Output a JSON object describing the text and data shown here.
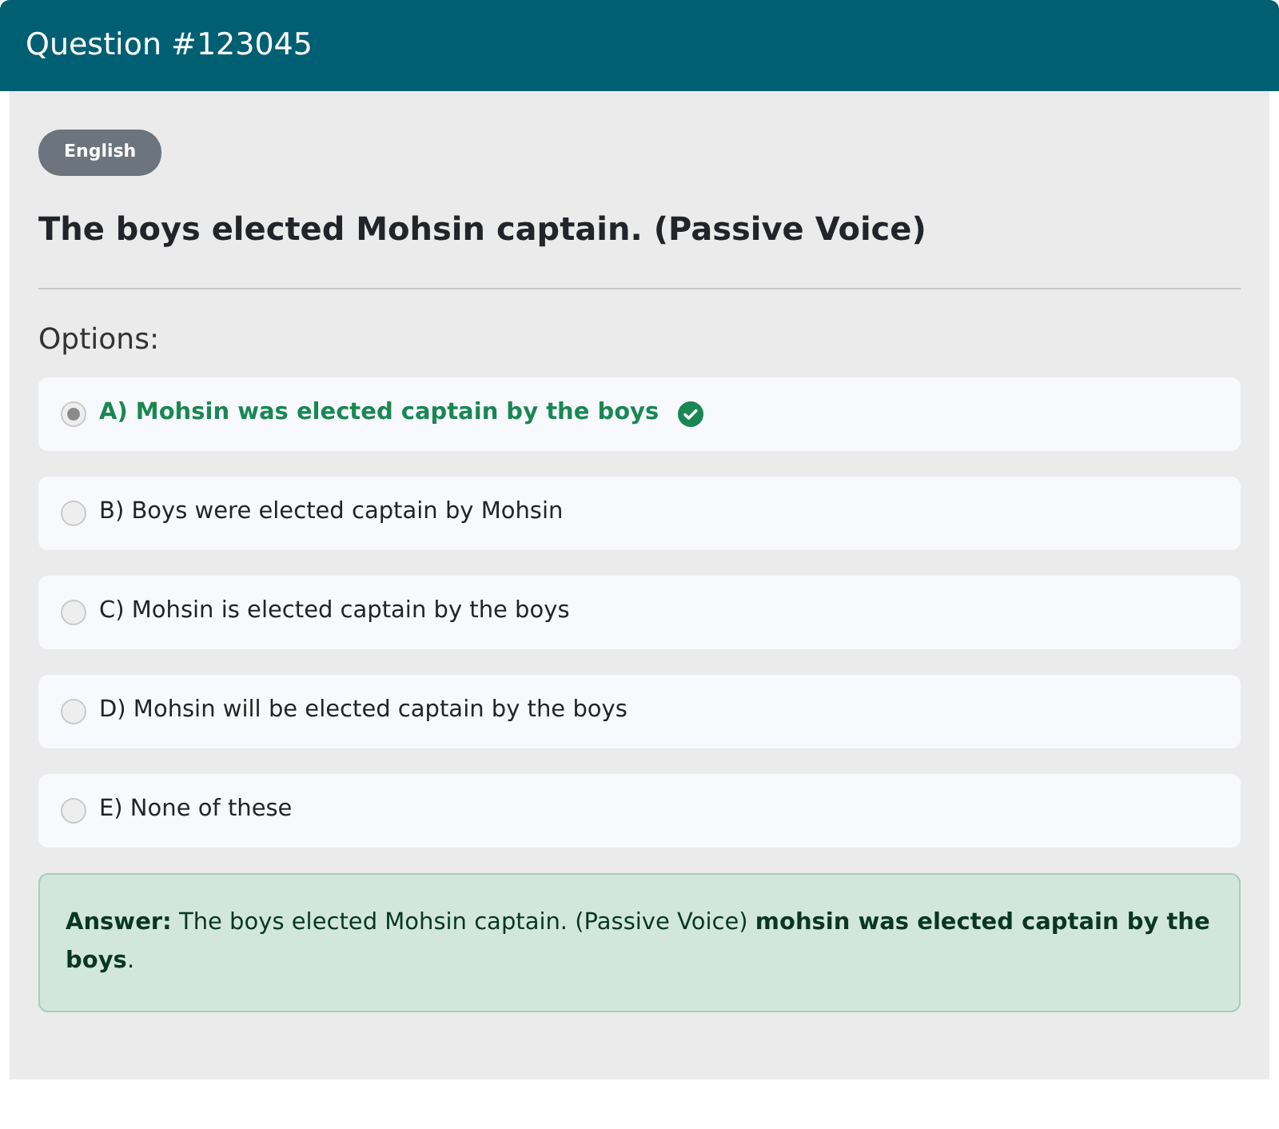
{
  "header": {
    "title": "Question #123045"
  },
  "language_badge": "English",
  "question": "The boys elected Mohsin captain. (Passive Voice)",
  "options_heading": "Options:",
  "options": [
    {
      "label": "A) Mohsin was elected captain by the boys",
      "selected": true,
      "correct": true
    },
    {
      "label": "B) Boys were elected captain by Mohsin",
      "selected": false,
      "correct": false
    },
    {
      "label": "C) Mohsin is elected captain by the boys",
      "selected": false,
      "correct": false
    },
    {
      "label": "D) Mohsin will be elected captain by the boys",
      "selected": false,
      "correct": false
    },
    {
      "label": "E) None of these",
      "selected": false,
      "correct": false
    }
  ],
  "answer": "**Answer:** The boys elected Mohsin captain. (Passive Voice) **mohsin was elected captain by the boys**."
}
